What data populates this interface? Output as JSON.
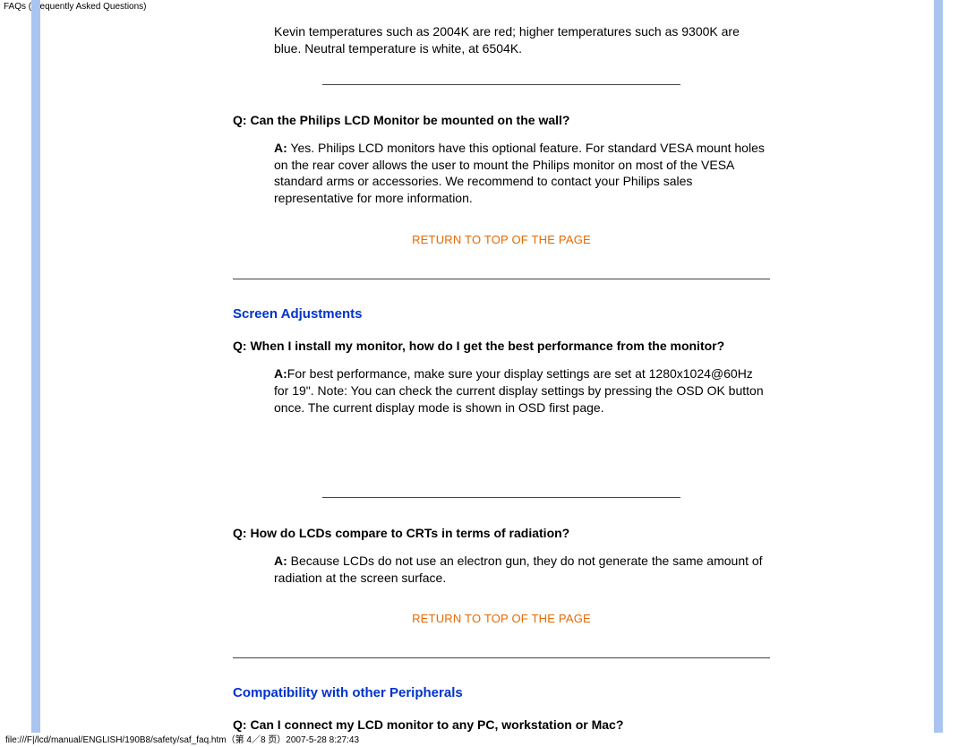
{
  "header": "FAQs (Frequently Asked Questions)",
  "intro": "Kevin temperatures such as 2004K are red; higher temperatures such as 9300K are blue. Neutral temperature is white, at 6504K.",
  "return_link": "RETURN TO TOP OF THE PAGE",
  "q1": {
    "label": "Q:",
    "text": " Can the Philips LCD Monitor be mounted on the wall?"
  },
  "a1": {
    "label": "A:",
    "text": " Yes. Philips LCD monitors have this optional feature. For standard VESA mount holes on the rear cover allows the user to mount the Philips monitor on most of the VESA standard arms or accessories. We recommend to contact your Philips sales representative for more information."
  },
  "section1_title": "Screen Adjustments",
  "q2": {
    "label": "Q:",
    "text": " When I install my monitor, how do I get the best performance from the monitor?"
  },
  "a2": {
    "label": "A:",
    "text": "For best performance, make sure your display settings are set at 1280x1024@60Hz for 19\". Note: You can check the current display settings by pressing the OSD OK button once. The current display mode is shown in OSD first page."
  },
  "q3": {
    "label": "Q:",
    "text": " How do LCDs compare to CRTs in terms of radiation?"
  },
  "a3": {
    "label": "A:",
    "text": " Because LCDs do not use an electron gun, they do not generate the same amount of radiation at the screen surface."
  },
  "section2_title": "Compatibility with other Peripherals",
  "q4": {
    "label": "Q:",
    "text": " Can I connect my LCD monitor to any PC, workstation or Mac?"
  },
  "footer": "file:///F|/lcd/manual/ENGLISH/190B8/safety/saf_faq.htm（第 4／8 页）2007-5-28 8:27:43"
}
